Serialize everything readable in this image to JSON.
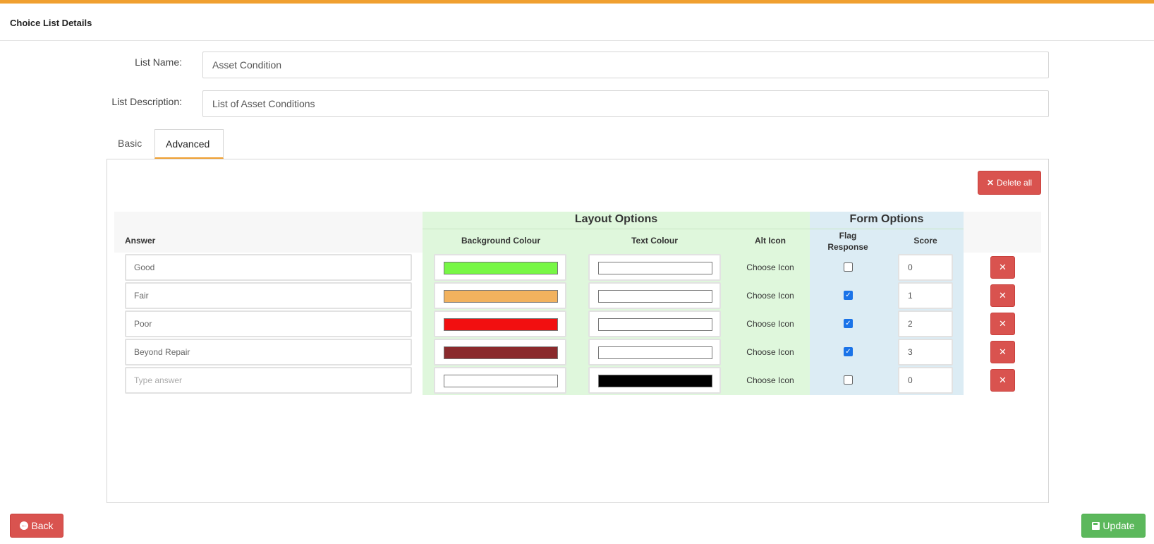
{
  "header": {
    "title": "Choice List Details"
  },
  "form": {
    "list_name_label": "List Name:",
    "list_name_value": "Asset Condition",
    "list_description_label": "List Description:",
    "list_description_value": "List of Asset Conditions"
  },
  "tabs": [
    {
      "label": "Basic",
      "active": false
    },
    {
      "label": "Advanced",
      "active": true
    }
  ],
  "panel": {
    "delete_all_label": "Delete all",
    "groups": {
      "layout": "Layout Options",
      "form": "Form Options"
    },
    "columns": {
      "answer": "Answer",
      "background_colour": "Background Colour",
      "text_colour": "Text Colour",
      "alt_icon": "Alt Icon",
      "flag_response_line1": "Flag",
      "flag_response_line2": "Response",
      "score": "Score"
    },
    "rows": [
      {
        "answer": "Good",
        "bg_colour": "#77f745",
        "text_colour": "#ffffff",
        "alt_icon": "Choose Icon",
        "flag": false,
        "score": "0"
      },
      {
        "answer": "Fair",
        "bg_colour": "#f2b25e",
        "text_colour": "#ffffff",
        "alt_icon": "Choose Icon",
        "flag": true,
        "score": "1"
      },
      {
        "answer": "Poor",
        "bg_colour": "#f20f10",
        "text_colour": "#ffffff",
        "alt_icon": "Choose Icon",
        "flag": true,
        "score": "2"
      },
      {
        "answer": "Beyond Repair",
        "bg_colour": "#8a2a2c",
        "text_colour": "#ffffff",
        "alt_icon": "Choose Icon",
        "flag": true,
        "score": "3"
      },
      {
        "answer": "",
        "answer_placeholder": "Type answer",
        "bg_colour": "#ffffff",
        "text_colour": "#000000",
        "alt_icon": "Choose Icon",
        "flag": false,
        "score": "0"
      }
    ]
  },
  "footer": {
    "back_label": "Back",
    "update_label": "Update"
  },
  "colors": {
    "accent_orange": "#f0a030",
    "danger_red": "#d9534f",
    "success_green": "#5cb85c",
    "layout_header_bg": "#dff7dc",
    "form_header_bg": "#dcecf4"
  }
}
